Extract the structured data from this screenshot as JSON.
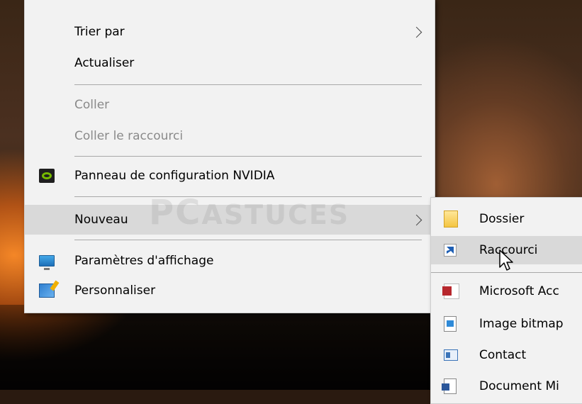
{
  "context_menu": {
    "items": [
      {
        "label": "Trier par",
        "has_submenu": true,
        "disabled": false
      },
      {
        "label": "Actualiser",
        "has_submenu": false,
        "disabled": false
      },
      {
        "label": "Coller",
        "disabled": true
      },
      {
        "label": "Coller le raccourci",
        "disabled": true
      },
      {
        "label": "Panneau de configuration NVIDIA",
        "icon": "nvidia-icon"
      },
      {
        "label": "Nouveau",
        "has_submenu": true,
        "highlighted": true
      },
      {
        "label": "Paramètres d'affichage",
        "icon": "display-settings-icon"
      },
      {
        "label": "Personnaliser",
        "icon": "personalize-icon"
      }
    ]
  },
  "submenu_nouveau": {
    "items": [
      {
        "label": "Dossier",
        "icon": "folder-icon"
      },
      {
        "label": "Raccourci",
        "icon": "shortcut-icon",
        "highlighted": true
      },
      {
        "label": "Microsoft Acc",
        "icon": "access-icon"
      },
      {
        "label": "Image bitmap",
        "icon": "bitmap-image-icon"
      },
      {
        "label": "Contact",
        "icon": "contact-icon"
      },
      {
        "label": "Document Mi",
        "icon": "word-document-icon"
      }
    ]
  },
  "watermark": {
    "main": "PC",
    "rest": "ASTUCES"
  },
  "colors": {
    "menu_bg": "#f2f2f2",
    "highlight": "#d9d9d9",
    "disabled_text": "#8a8a8a"
  }
}
